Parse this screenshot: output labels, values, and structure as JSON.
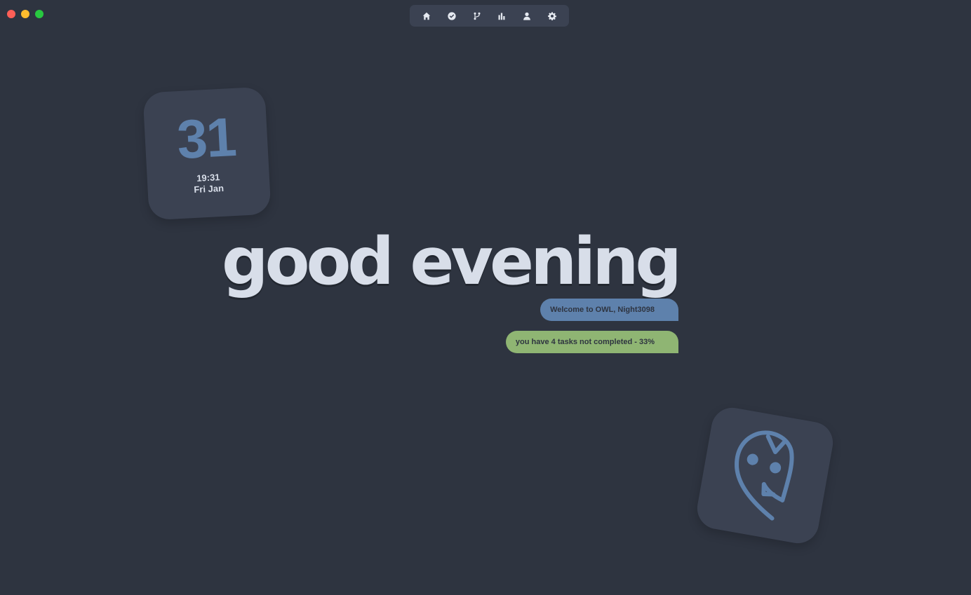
{
  "window": {
    "traffic_lights": [
      {
        "name": "close",
        "color": "#ff5f57"
      },
      {
        "name": "minimize",
        "color": "#febc2e"
      },
      {
        "name": "maximize",
        "color": "#28c840"
      }
    ]
  },
  "navbar": {
    "items": [
      {
        "icon": "home-icon"
      },
      {
        "icon": "check-circle-icon"
      },
      {
        "icon": "git-branch-icon"
      },
      {
        "icon": "bar-chart-icon"
      },
      {
        "icon": "user-icon"
      },
      {
        "icon": "gear-icon"
      }
    ]
  },
  "date_widget": {
    "day": "31",
    "time": "19:31",
    "weekday_month": "Fri Jan"
  },
  "greeting": {
    "title": "good evening",
    "welcome": "Welcome to OWL, Night3098",
    "tasks": "you have 4 tasks not completed - 33%"
  },
  "colors": {
    "background": "#2e3440",
    "card": "#3b4252",
    "accent_blue": "#5e81ac",
    "accent_green": "#8fb573",
    "text": "#d8dee9"
  },
  "logo": {
    "icon": "owl-icon"
  }
}
